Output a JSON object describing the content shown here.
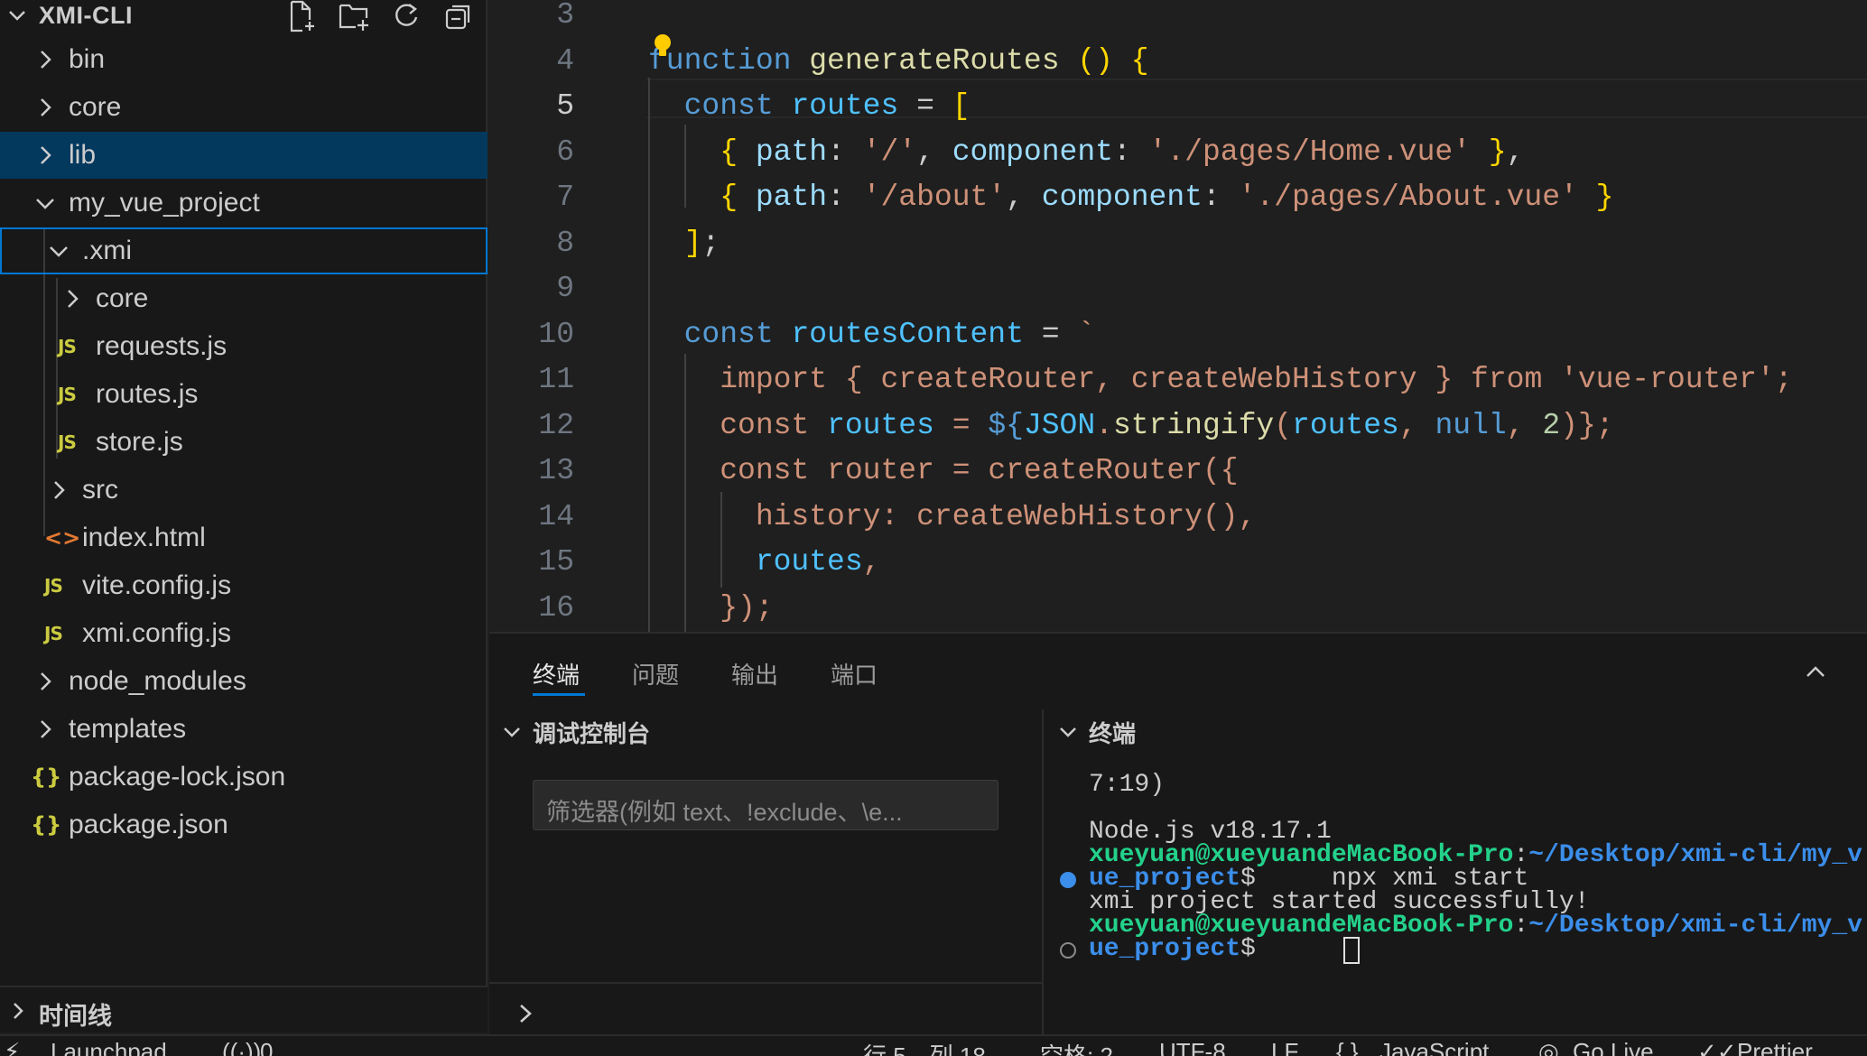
{
  "explorer": {
    "title": "XMI-CLI",
    "actions": [
      "new-file-icon",
      "new-folder-icon",
      "refresh-icon",
      "collapse-all-icon"
    ],
    "items": [
      {
        "label": "bin",
        "type": "folder",
        "expanded": false
      },
      {
        "label": "core",
        "type": "folder",
        "expanded": false
      },
      {
        "label": "lib",
        "type": "folder",
        "expanded": false
      },
      {
        "label": "my_vue_project",
        "type": "folder",
        "expanded": true
      },
      {
        "label": ".xmi",
        "type": "folder",
        "expanded": true
      },
      {
        "label": "core",
        "type": "folder",
        "expanded": false
      },
      {
        "label": "requests.js",
        "type": "js",
        "icon_text": "JS"
      },
      {
        "label": "routes.js",
        "type": "js",
        "icon_text": "JS"
      },
      {
        "label": "store.js",
        "type": "js",
        "icon_text": "JS"
      },
      {
        "label": "src",
        "type": "folder",
        "expanded": false
      },
      {
        "label": "index.html",
        "type": "html",
        "icon_text": "<>"
      },
      {
        "label": "vite.config.js",
        "type": "js",
        "icon_text": "JS"
      },
      {
        "label": "xmi.config.js",
        "type": "js",
        "icon_text": "JS"
      },
      {
        "label": "node_modules",
        "type": "folder",
        "expanded": false
      },
      {
        "label": "templates",
        "type": "folder",
        "expanded": false
      },
      {
        "label": "package-lock.json",
        "type": "json",
        "icon_text": "{}"
      },
      {
        "label": "package.json",
        "type": "json",
        "icon_text": "{}"
      }
    ],
    "timeline_label": "时间线"
  },
  "editor": {
    "current_line": "5",
    "lines": [
      {
        "n": "3",
        "code": ""
      },
      {
        "n": "4",
        "code": "function generateRoutes () {"
      },
      {
        "n": "5",
        "code": "  const routes = ["
      },
      {
        "n": "6",
        "code": "    { path: '/', component: './pages/Home.vue' },"
      },
      {
        "n": "7",
        "code": "    { path: '/about', component: './pages/About.vue' }"
      },
      {
        "n": "8",
        "code": "  ];"
      },
      {
        "n": "9",
        "code": ""
      },
      {
        "n": "10",
        "code": "  const routesContent = `"
      },
      {
        "n": "11",
        "code": "    import { createRouter, createWebHistory } from 'vue-router';"
      },
      {
        "n": "12",
        "code": "    const routes = ${JSON.stringify(routes, null, 2)};"
      },
      {
        "n": "13",
        "code": "    const router = createRouter({"
      },
      {
        "n": "14",
        "code": "      history: createWebHistory(),"
      },
      {
        "n": "15",
        "code": "      routes,"
      },
      {
        "n": "16",
        "code": "    });"
      }
    ]
  },
  "panel": {
    "tabs": [
      "终端",
      "问题",
      "输出",
      "端口"
    ],
    "active_tab": "终端",
    "debug_console": {
      "title": "调试控制台",
      "filter_placeholder": "筛选器(例如 text、!exclude、\\e..."
    },
    "terminal": {
      "title": "终端",
      "lines": [
        {
          "text": "7:19)"
        },
        {
          "text": ""
        },
        {
          "text": "Node.js v18.17.1"
        },
        {
          "user": "xueyuan@xueyuandeMacBook-Pro",
          "path": "~/Desktop/xmi-cli/my_v"
        },
        {
          "path": "ue_project",
          "prompt": "$",
          "command": "     npx xmi start",
          "dot": "filled"
        },
        {
          "text": "xmi project started successfully!"
        },
        {
          "user": "xueyuan@xueyuandeMacBook-Pro",
          "path": "~/Desktop/xmi-cli/my_v"
        },
        {
          "path": "ue_project",
          "prompt": "$",
          "dot": "hollow"
        }
      ]
    }
  },
  "status_bar": {
    "launchpad": "Launchpad",
    "ports": "0",
    "position": "行 5，列 18",
    "spaces": "空格: 2",
    "encoding": "UTF-8",
    "eol": "LF",
    "language": "JavaScript",
    "go_live": "Go Live",
    "prettier": "Prettier"
  },
  "colors": {
    "selection": "#04395e",
    "focus_border": "#0078d4",
    "js_icon": "#cbcb41",
    "html_icon": "#e37933",
    "terminal_user": "#23d18b",
    "terminal_path": "#3b8eea"
  }
}
